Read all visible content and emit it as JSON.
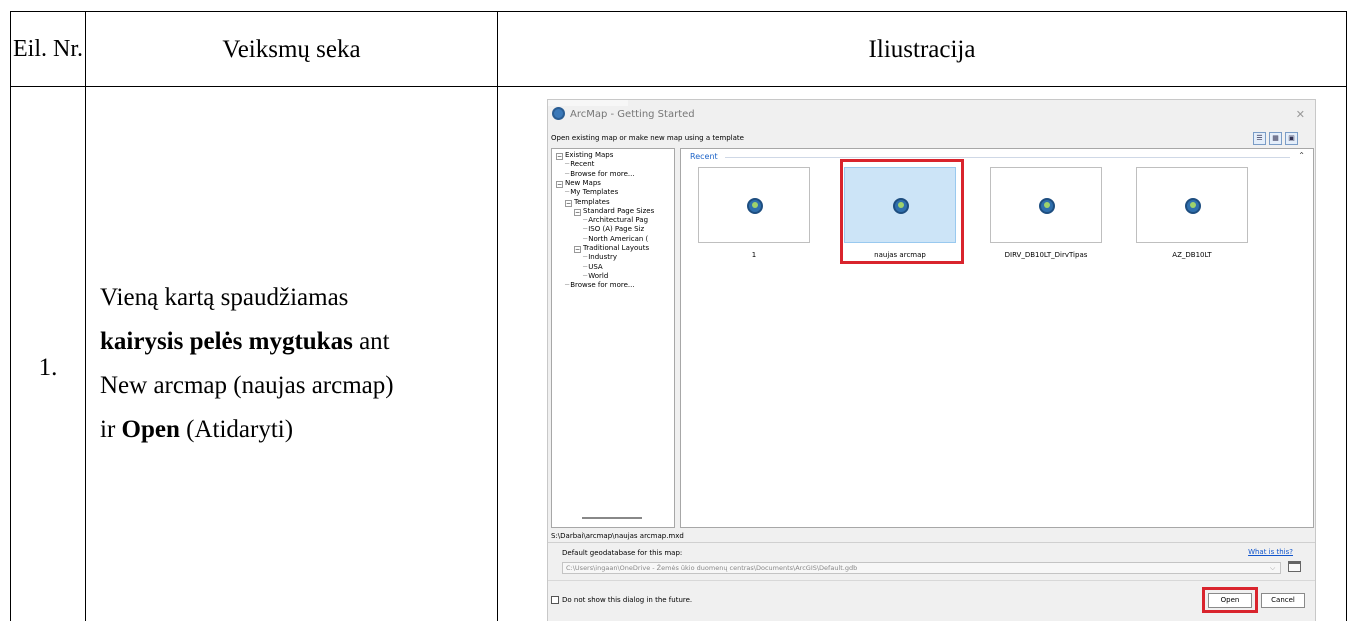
{
  "table": {
    "header": {
      "col1": "Eil. Nr.",
      "col2": "Veiksmų seka",
      "col3": "Iliustracija"
    },
    "rows": [
      {
        "number": "1.",
        "step_line1": "Vieną kartą spaudžiamas",
        "step_bold1": "kairysis pelės mygtukas",
        "step_text2": " ant",
        "step_line3": "New arcmap (naujas arcmap)",
        "step_text4": "ir ",
        "step_bold4": "Open",
        "step_text5": " (Atidaryti)"
      }
    ]
  },
  "dialog": {
    "title": "ArcMap - Getting Started",
    "close_icon": "✕",
    "subtitle": "Open existing map or make new map using a template",
    "tree": [
      {
        "label": "Existing Maps",
        "toggle": "−",
        "indent": 0
      },
      {
        "label": "Recent",
        "toggle": "",
        "indent": 1
      },
      {
        "label": "Browse for more...",
        "toggle": "",
        "indent": 1
      },
      {
        "label": "New Maps",
        "toggle": "−",
        "indent": 0
      },
      {
        "label": "My Templates",
        "toggle": "",
        "indent": 1
      },
      {
        "label": "Templates",
        "toggle": "−",
        "indent": 1
      },
      {
        "label": "Standard Page Sizes",
        "toggle": "−",
        "indent": 2
      },
      {
        "label": "Architectural Pag",
        "toggle": "",
        "indent": 3
      },
      {
        "label": "ISO (A) Page Siz",
        "toggle": "",
        "indent": 3
      },
      {
        "label": "North American (",
        "toggle": "",
        "indent": 3
      },
      {
        "label": "Traditional Layouts",
        "toggle": "−",
        "indent": 2
      },
      {
        "label": "Industry",
        "toggle": "",
        "indent": 3
      },
      {
        "label": "USA",
        "toggle": "",
        "indent": 3
      },
      {
        "label": "World",
        "toggle": "",
        "indent": 3
      },
      {
        "label": "Browse for more...",
        "toggle": "",
        "indent": 1
      }
    ],
    "recent_label": "Recent",
    "templates": [
      {
        "name": "1",
        "selected": false
      },
      {
        "name": "naujas arcmap",
        "selected": true
      },
      {
        "name": "DIRV_DB10LT_DirvTipas",
        "selected": false
      },
      {
        "name": "AZ_DB10LT",
        "selected": false
      }
    ],
    "path": "S:\\Darbai\\arcmap\\naujas arcmap.mxd",
    "gdb_label": "Default geodatabase for this map:",
    "what_link": "What is this?",
    "gdb_path": "C:\\Users\\ingaan\\OneDrive - Žemės ūkio duomenų centras\\Documents\\ArcGIS\\Default.gdb",
    "checkbox_label": "Do not show this dialog in the future.",
    "open_label": "Open",
    "cancel_label": "Cancel",
    "highlight_color": "#d9242d"
  }
}
